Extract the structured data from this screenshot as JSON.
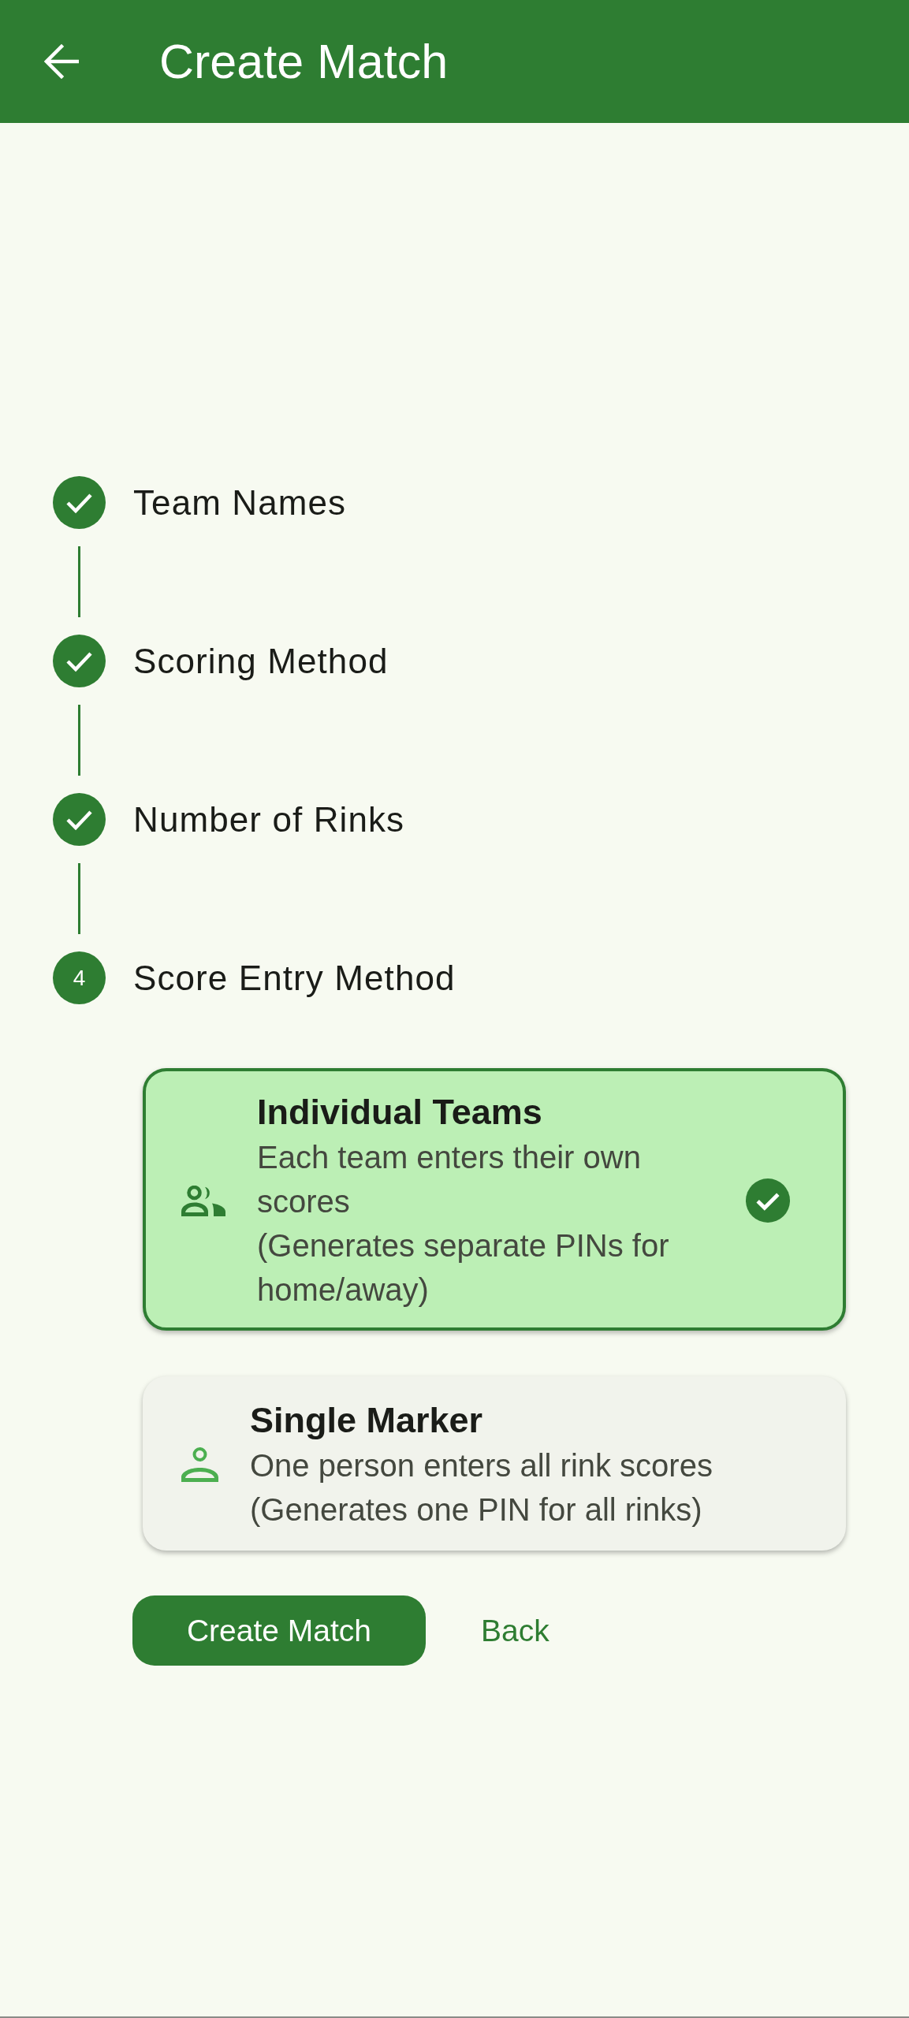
{
  "app_bar": {
    "title": "Create Match"
  },
  "steps": [
    {
      "label": "Team Names",
      "completed": true
    },
    {
      "label": "Scoring Method",
      "completed": true
    },
    {
      "label": "Number of Rinks",
      "completed": true
    },
    {
      "label": "Score Entry Method",
      "completed": false,
      "number": "4"
    }
  ],
  "options": [
    {
      "title": "Individual Teams",
      "description": "Each team enters their own scores",
      "note": "(Generates separate PINs for home/away)",
      "selected": true
    },
    {
      "title": "Single Marker",
      "description": "One person enters all rink scores",
      "note": "(Generates one PIN for all rinks)",
      "selected": false
    }
  ],
  "actions": {
    "primary": "Create Match",
    "secondary": "Back"
  }
}
